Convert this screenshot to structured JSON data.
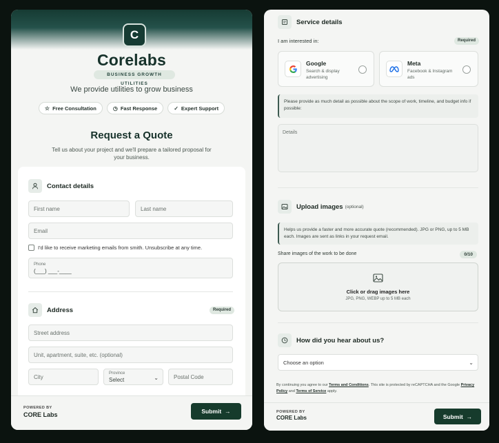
{
  "brand": {
    "logo_letter": "C",
    "name": "Corelabs",
    "subtitle": "BUSINESS GROWTH UTILITIES",
    "tagline": "We provide utilities to grow business"
  },
  "chips": [
    {
      "icon": "star-icon",
      "label": "Free Consultation"
    },
    {
      "icon": "clock-icon",
      "label": "Fast Response"
    },
    {
      "icon": "check-icon",
      "label": "Expert Support"
    }
  ],
  "quote": {
    "title": "Request a Quote",
    "description": "Tell us about your project and we'll prepare a tailored proposal for your business."
  },
  "contact": {
    "title": "Contact details",
    "first_name_placeholder": "First name",
    "last_name_placeholder": "Last name",
    "email_placeholder": "Email",
    "marketing_label": "I'd like to receive marketing emails from smith. Unsubscribe at any time.",
    "phone_label": "Phone",
    "phone_mask": "(___) ___-____"
  },
  "address": {
    "title": "Address",
    "badge": "Required",
    "street_placeholder": "Street address",
    "unit_placeholder": "Unit, apartment, suite, etc. (optional)",
    "city_placeholder": "City",
    "province_label": "Province",
    "province_value": "Select",
    "postal_placeholder": "Postal Code"
  },
  "footer": {
    "powered_small": "POWERED BY",
    "powered_big": "CORE Labs",
    "submit_label": "Submit",
    "submit_arrow": "→"
  },
  "service": {
    "title": "Service details",
    "interest_label": "I am interested in:",
    "badge": "Required",
    "options": [
      {
        "name": "Google",
        "desc": "Search & display advertising",
        "icon": "google-icon"
      },
      {
        "name": "Meta",
        "desc": "Facebook & Instagram ads",
        "icon": "meta-icon"
      }
    ],
    "note": "Please provide as much detail as possible about the scope of work, timeline, and budget info if possible:",
    "details_placeholder": "Details"
  },
  "upload": {
    "title": "Upload images",
    "optional": "(optional)",
    "note": "Helps us provide a faster and more accurate quote (recommended). JPG or PNG, up to 5 MB each. Images are sent as links in your request email.",
    "share_label": "Share images of the work to be done",
    "counter": "0/10",
    "drop_main": "Click or drag images here",
    "drop_sub": "JPG, PNG, WEBP up to 5 MB each"
  },
  "referral": {
    "title": "How did you hear about us?",
    "select_value": "Choose an option"
  },
  "legal": {
    "t1": "By continuing you agree to our ",
    "terms": "Terms and Conditions",
    "t2": ". This site is protected by reCAPTCHA and the Google ",
    "privacy": "Privacy Policy",
    "t3": " and ",
    "tos": "Terms of Service",
    "t4": " apply."
  },
  "colors": {
    "accent": "#163b2c",
    "page_bg": "#0b130f",
    "panel_bg": "#f4f5f3"
  }
}
